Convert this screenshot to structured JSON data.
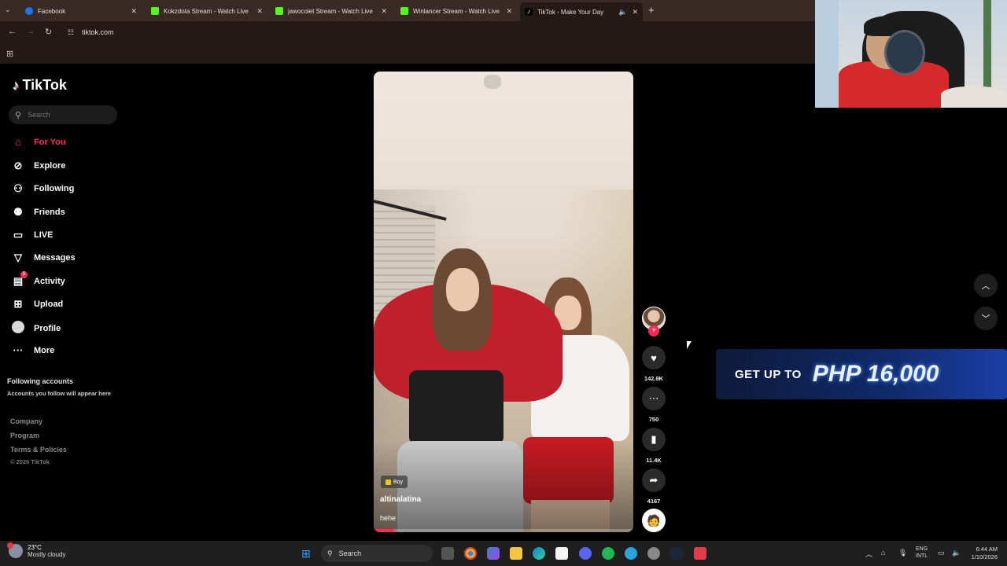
{
  "browser": {
    "tabs": [
      {
        "title": "Facebook",
        "color": "#1877f2",
        "active": false
      },
      {
        "title": "Kokzdota Stream - Watch Live",
        "color": "#53fc18",
        "active": false
      },
      {
        "title": "jawocolet Stream - Watch Live",
        "color": "#53fc18",
        "active": false
      },
      {
        "title": "Winlancer Stream - Watch Live",
        "color": "#53fc18",
        "active": false
      },
      {
        "title": "TikTok - Make Your Day",
        "color": "#000000",
        "active": true
      }
    ],
    "url": "tiktok.com"
  },
  "sidebar": {
    "brand": "TikTok",
    "search_placeholder": "Search",
    "nav": [
      {
        "label": "For You",
        "icon": "home-icon",
        "active": true
      },
      {
        "label": "Explore",
        "icon": "compass-icon",
        "active": false
      },
      {
        "label": "Following",
        "icon": "following-icon",
        "active": false
      },
      {
        "label": "Friends",
        "icon": "friends-icon",
        "active": false
      },
      {
        "label": "LIVE",
        "icon": "live-icon",
        "active": false
      },
      {
        "label": "Messages",
        "icon": "messages-icon",
        "active": false
      },
      {
        "label": "Activity",
        "icon": "activity-icon",
        "active": false,
        "badge": "5"
      },
      {
        "label": "Upload",
        "icon": "upload-icon",
        "active": false
      },
      {
        "label": "Profile",
        "icon": "profile-icon",
        "active": false
      },
      {
        "label": "More",
        "icon": "more-icon",
        "active": false
      }
    ],
    "following_title": "Following accounts",
    "following_subtitle": "Accounts you follow will appear here",
    "footer": [
      "Company",
      "Program",
      "Terms & Policies"
    ],
    "copyright": "© 2026 TikTok"
  },
  "video": {
    "tag": "Boy",
    "username": "altinalatina",
    "caption": "hehe",
    "progress": 0.08
  },
  "actions": {
    "likes": "142.9K",
    "comments": "750",
    "saves": "11.4K",
    "shares": "4167"
  },
  "promo": {
    "prefix": "GET UP TO",
    "amount": "PHP 16,000"
  },
  "taskbar": {
    "temp": "23°C",
    "weather": "Mostly cloudy",
    "search_label": "Search",
    "lang_top": "ENG",
    "lang_bottom": "INTL",
    "time": "6:44 AM",
    "date": "1/10/2026"
  },
  "colors": {
    "accent": "#fe2c55",
    "background": "#000000",
    "chrome": "#241915"
  }
}
